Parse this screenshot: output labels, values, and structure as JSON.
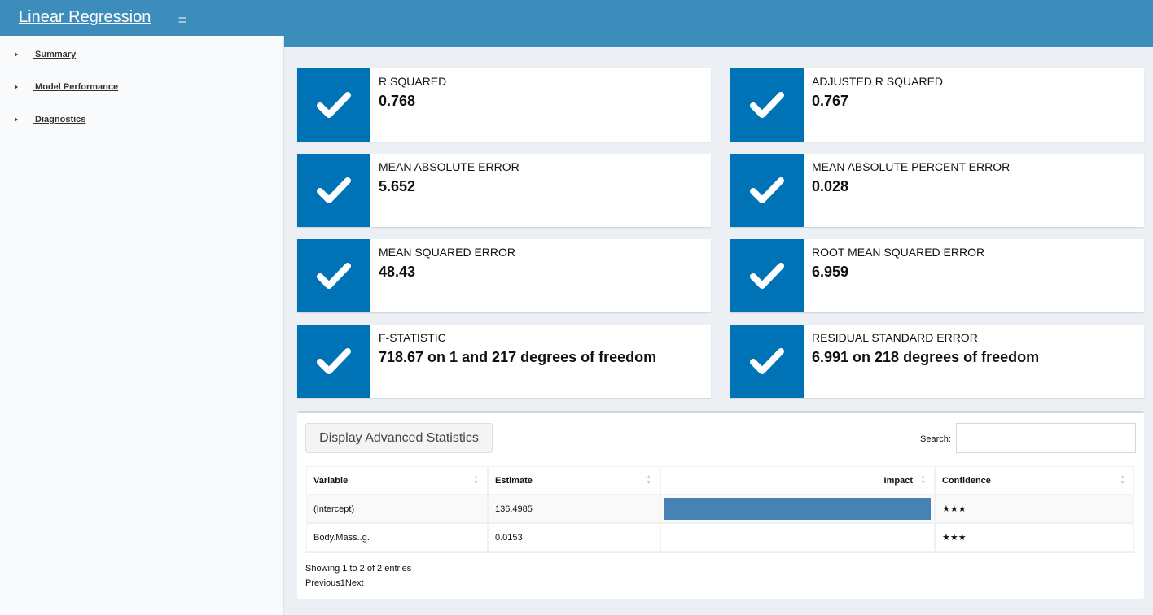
{
  "header": {
    "title": "Linear Regression",
    "toggle_icon": "≣"
  },
  "sidebar": {
    "items": [
      {
        "label": " Summary"
      },
      {
        "label": " Model Performance"
      },
      {
        "label": " Diagnostics"
      }
    ]
  },
  "cards": [
    {
      "title": "R SQUARED",
      "value": "0.768"
    },
    {
      "title": "ADJUSTED R SQUARED",
      "value": "0.767"
    },
    {
      "title": "MEAN ABSOLUTE ERROR",
      "value": "5.652"
    },
    {
      "title": "MEAN ABSOLUTE PERCENT ERROR",
      "value": "0.028"
    },
    {
      "title": "MEAN SQUARED ERROR",
      "value": "48.43"
    },
    {
      "title": "ROOT MEAN SQUARED ERROR",
      "value": "6.959"
    },
    {
      "title": "F-STATISTIC",
      "value": "718.67 on 1 and 217 degrees of freedom"
    },
    {
      "title": "RESIDUAL STANDARD ERROR",
      "value": "6.991 on 218 degrees of freedom"
    }
  ],
  "panel": {
    "button_label": "Display Advanced Statistics",
    "search_label": "Search:",
    "search_value": "",
    "columns": [
      "Variable",
      "Estimate",
      "Impact",
      "Confidence"
    ],
    "rows": [
      {
        "variable": "(Intercept)",
        "estimate": "136.4985",
        "impact_fraction": 1.0,
        "confidence": "★★★"
      },
      {
        "variable": "Body.Mass..g.",
        "estimate": "0.0153",
        "impact_fraction": 0.0,
        "confidence": "★★★"
      }
    ],
    "info": "Showing 1 to 2 of 2 entries",
    "pager": {
      "previous": "Previous",
      "page": "1",
      "next": "Next"
    }
  },
  "colors": {
    "header": "#3c8dbc",
    "icon_box": "#0073b7",
    "impact_bar": "#4682b4"
  }
}
